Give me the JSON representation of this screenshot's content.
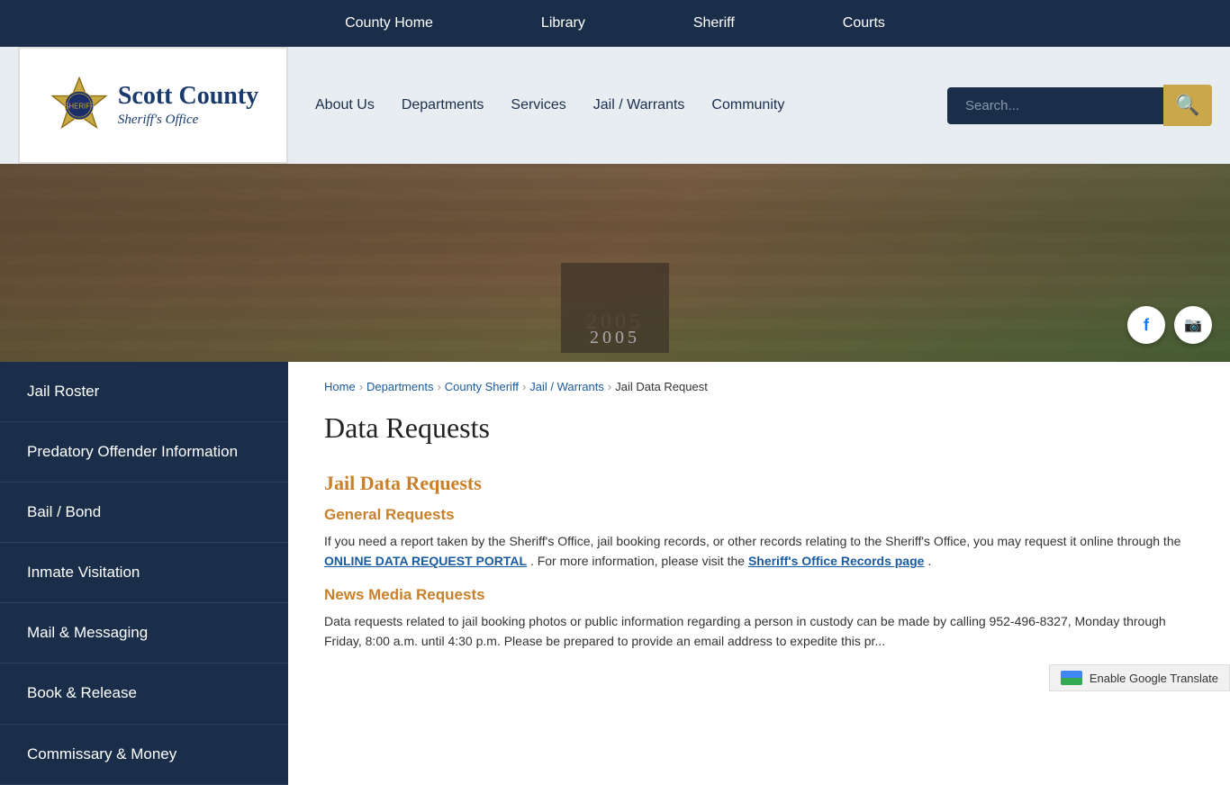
{
  "topbar": {
    "links": [
      {
        "label": "County Home",
        "href": "#"
      },
      {
        "label": "Library",
        "href": "#"
      },
      {
        "label": "Sheriff",
        "href": "#"
      },
      {
        "label": "Courts",
        "href": "#"
      }
    ]
  },
  "logo": {
    "county": "Scott County",
    "tagline": "Sheriff's Office"
  },
  "nav": {
    "links": [
      {
        "label": "About Us",
        "href": "#"
      },
      {
        "label": "Departments",
        "href": "#"
      },
      {
        "label": "Services",
        "href": "#"
      },
      {
        "label": "Jail / Warrants",
        "href": "#"
      },
      {
        "label": "Community",
        "href": "#"
      }
    ],
    "search_placeholder": "Search..."
  },
  "sidebar": {
    "items": [
      {
        "label": "Jail Roster",
        "href": "#"
      },
      {
        "label": "Predatory Offender Information",
        "href": "#"
      },
      {
        "label": "Bail / Bond",
        "href": "#"
      },
      {
        "label": "Inmate Visitation",
        "href": "#"
      },
      {
        "label": "Mail & Messaging",
        "href": "#"
      },
      {
        "label": "Book & Release",
        "href": "#"
      },
      {
        "label": "Commissary & Money",
        "href": "#"
      }
    ]
  },
  "breadcrumb": {
    "items": [
      {
        "label": "Home",
        "href": "#"
      },
      {
        "label": "Departments",
        "href": "#"
      },
      {
        "label": "County Sheriff",
        "href": "#"
      },
      {
        "label": "Jail / Warrants",
        "href": "#"
      },
      {
        "label": "Jail Data Request",
        "current": true
      }
    ]
  },
  "content": {
    "page_title": "Data Requests",
    "section1_h2": "Jail Data Requests",
    "section1_h3": "General Requests",
    "section1_body": "If you need a report taken by the Sheriff's Office, jail booking records, or other records relating to the Sheriff's Office, you may request it online through the",
    "portal_link_text": "ONLINE DATA REQUEST PORTAL",
    "section1_body2": ". For more information, please visit the",
    "records_link_text": "Sheriff's Office Records page",
    "section1_body3": ".",
    "section2_h3": "News Media Requests",
    "section2_body": "Data requests related to jail booking photos or public information regarding a person in custody can be made by calling 952-496-8327, Monday through Friday, 8:00 a.m. until 4:30 p.m. Please be prepared to provide an email address to expedite this pr..."
  },
  "translate": {
    "label": "Enable Google Translate"
  }
}
